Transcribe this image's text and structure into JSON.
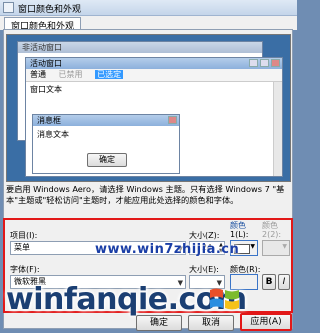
{
  "window": {
    "title": "窗口颜色和外观"
  },
  "tabs": [
    {
      "label": "窗口颜色和外观"
    }
  ],
  "preview": {
    "inactive_title": "非活动窗口",
    "active_title": "活动窗口",
    "menu": {
      "normal": "普通",
      "disabled": "已禁用",
      "selected": "已选定"
    },
    "window_text": "窗口文本",
    "msgbox_title": "消息框",
    "msgbox_text": "消息文本",
    "ok_button": "确定"
  },
  "description": "要启用 Windows Aero，请选择 Windows 主题。只有选择 Windows 7 \"基本\"主题或\"轻松访问\"主题时，才能应用此处选择的颜色和字体。",
  "form": {
    "item_label": "项目(I):",
    "item_value": "菜单",
    "size_label": "大小(Z):",
    "size_value": "24",
    "color1_header": "颜色",
    "color1_label": "1(L):",
    "color2_header": "颜色",
    "color2_label": "2(2):",
    "font_label": "字体(F):",
    "font_value": "微软雅黑",
    "font_size_label": "大小(E):",
    "font_color_label": "颜色(R):"
  },
  "buttons": {
    "ok": "确定",
    "cancel": "取消",
    "apply": "应用(A)"
  },
  "watermark": {
    "url": "www.win7zhijia.cn",
    "brand": "winfanqie.com"
  },
  "colors": {
    "highlight": "#e21818",
    "desktop": "#3a6ea5"
  }
}
